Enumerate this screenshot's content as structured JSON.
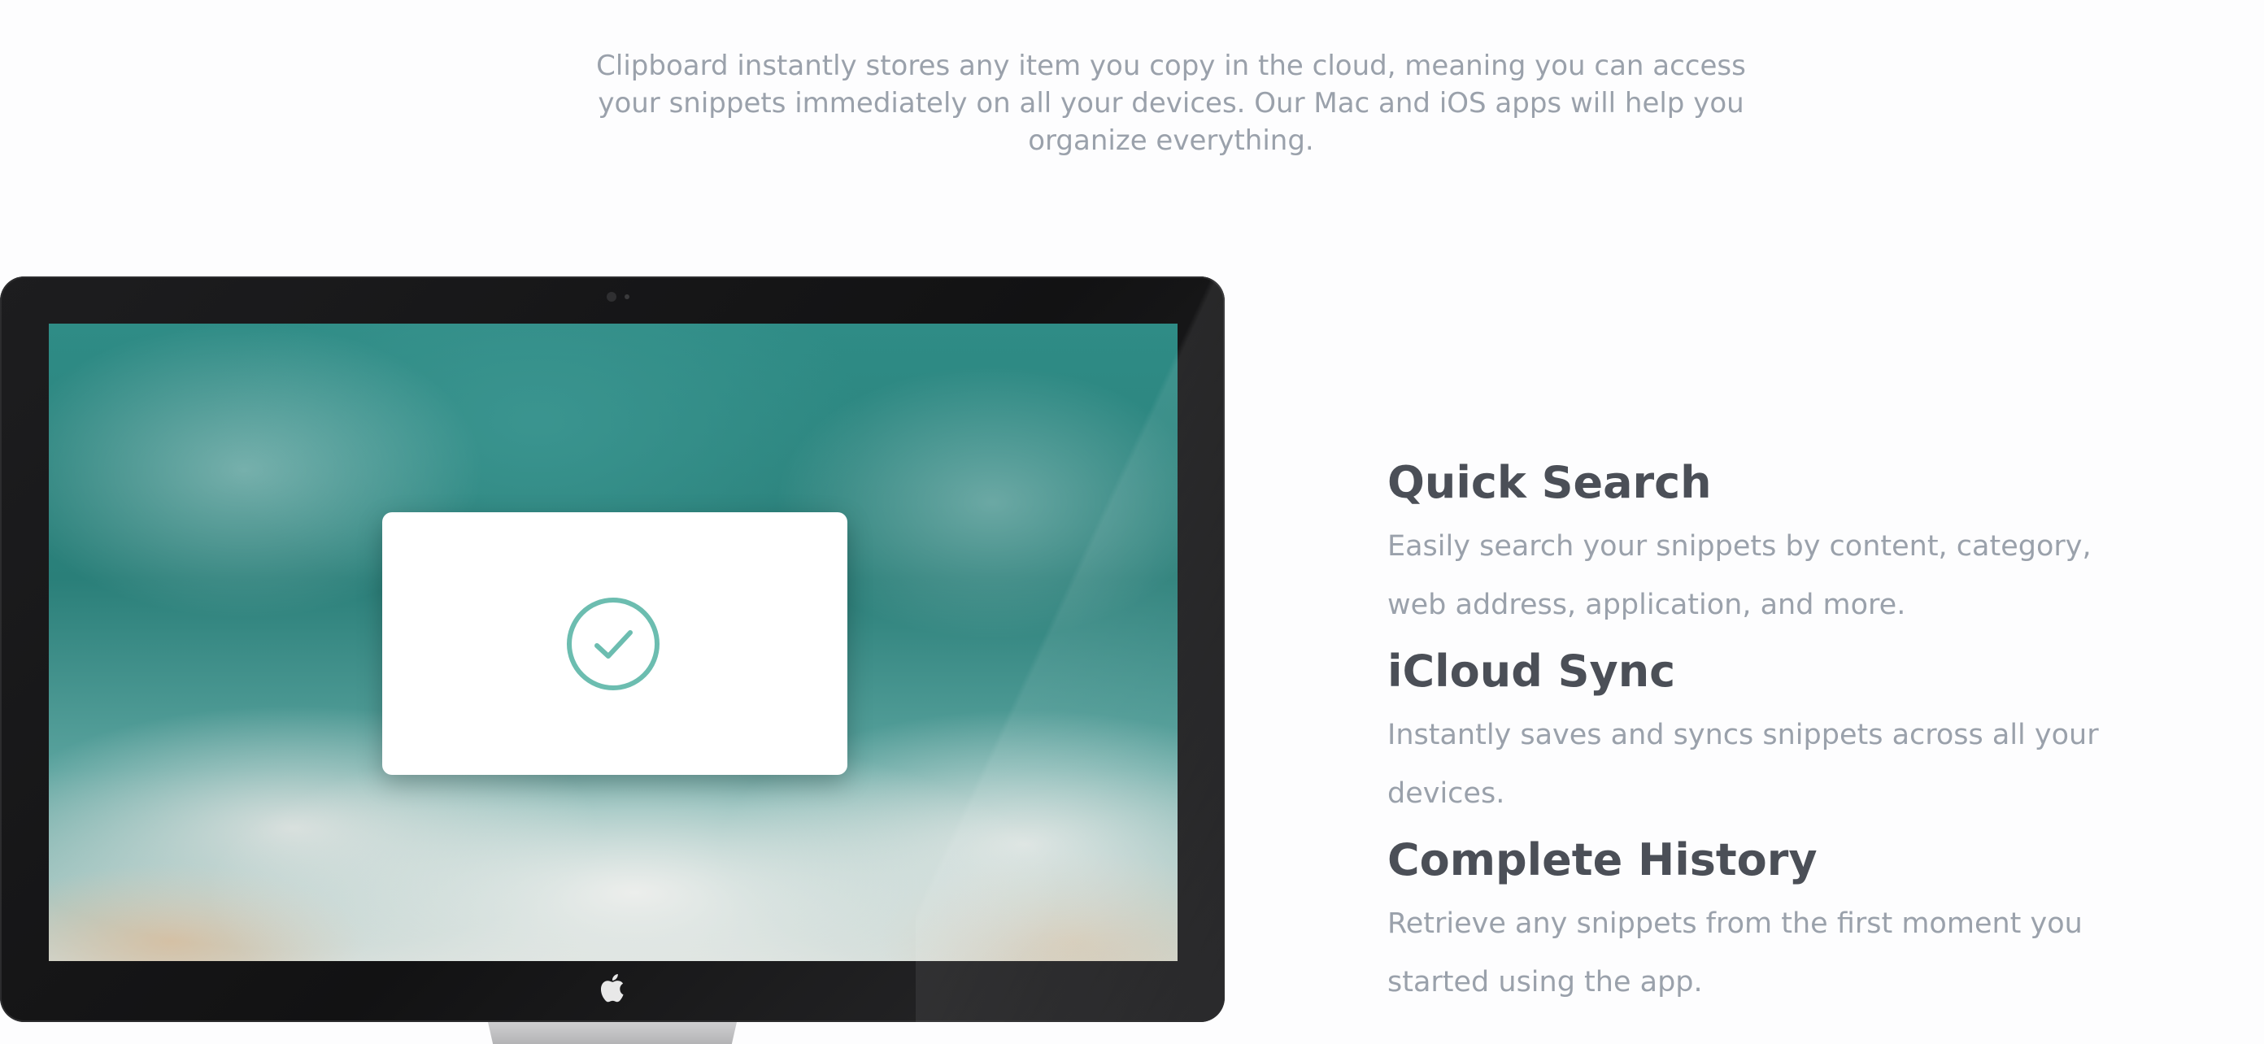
{
  "intro": {
    "text": "Clipboard instantly stores any item you copy in the cloud, meaning you can access your snippets immediately on all your devices. Our Mac and iOS apps will help you organize everything."
  },
  "device": {
    "screen_icons": [
      "check-circle-icon",
      "apple-logo-icon"
    ],
    "accent_color": "#5dbaa9"
  },
  "features": [
    {
      "title": "Quick Search",
      "description": "Easily search your snippets by content, category, web address, application, and more."
    },
    {
      "title": "iCloud Sync",
      "description": "Instantly saves and syncs snippets across all your devices."
    },
    {
      "title": "Complete History",
      "description": "Retrieve any snippets from the first moment you started using the app."
    }
  ]
}
